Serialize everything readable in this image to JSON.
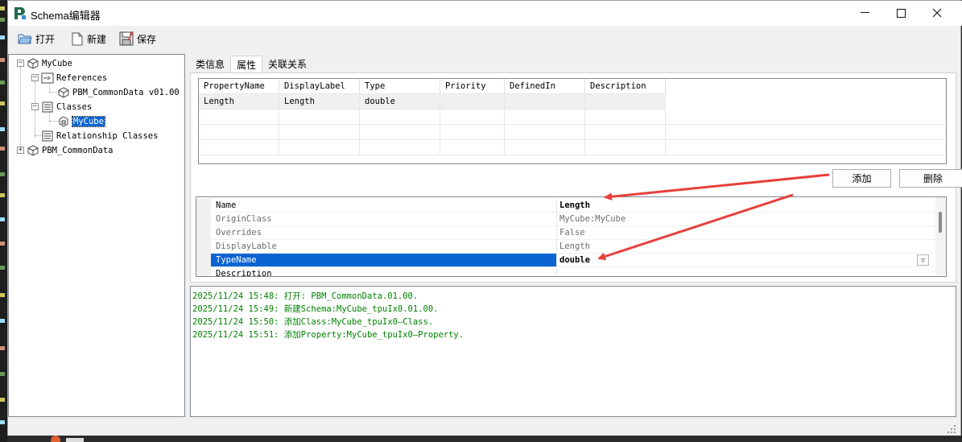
{
  "window": {
    "title": "Schema编辑器",
    "minimize_glyph": "─",
    "maximize_glyph": "☐",
    "close_glyph": "✕"
  },
  "toolbar": {
    "open_label": "打开",
    "new_label": "新建",
    "save_label": "保存"
  },
  "tree": {
    "root": "MyCube",
    "references": "References",
    "ref_item": "PBM_CommonData v01.00",
    "classes": "Classes",
    "class_item": "MyCube",
    "relationship_classes": "Relationship Classes",
    "second_root": "PBM_CommonData"
  },
  "tabs": [
    "类信息",
    "属性",
    "关联关系"
  ],
  "property_table": {
    "headers": [
      "PropertyName",
      "DisplayLabel",
      "Type",
      "Priority",
      "DefinedIn",
      "Description"
    ],
    "rows": [
      [
        "Length",
        "Length",
        "double",
        "",
        "",
        ""
      ]
    ]
  },
  "buttons": {
    "add": "添加",
    "delete": "删除"
  },
  "property_editor": {
    "rows": [
      {
        "name": "Name",
        "value": "Length"
      },
      {
        "name": "OriginClass",
        "value": "MyCube:MyCube"
      },
      {
        "name": "Overrides",
        "value": "False"
      },
      {
        "name": "DisplayLable",
        "value": "Length"
      },
      {
        "name": "TypeName",
        "value": "double"
      },
      {
        "name": "Description",
        "value": ""
      }
    ]
  },
  "log": [
    "2025/11/24 15:48: 打开: PBM_CommonData.01.00.",
    "2025/11/24 15:49: 新建Schema:MyCube_tpuIx0.01.00.",
    "2025/11/24 15:50: 添加Class:MyCube_tpuIx0—Class.",
    "2025/11/24 15:51: 添加Property:MyCube_tpuIx0—Property."
  ],
  "colors": {
    "selection": "#0a64d2",
    "log_text": "#008000",
    "annotation_arrow": "#e8403a"
  }
}
